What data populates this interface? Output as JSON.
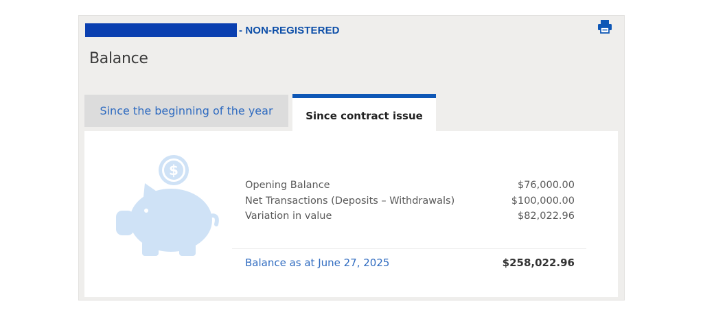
{
  "header": {
    "account_suffix": "- NON-REGISTERED",
    "print_icon": "printer-icon"
  },
  "section": {
    "title": "Balance"
  },
  "tabs": [
    {
      "label": "Since the beginning of the year",
      "active": false
    },
    {
      "label": "Since contract issue",
      "active": true
    }
  ],
  "summary": {
    "illustration_icon": "piggy-bank-dollar-icon",
    "rows": [
      {
        "label": "Opening Balance",
        "value": "$76,000.00"
      },
      {
        "label": "Net Transactions (Deposits – Withdrawals)",
        "value": "$100,000.00"
      },
      {
        "label": "Variation in value",
        "value": "$82,022.96"
      }
    ],
    "total": {
      "label": "Balance as at June 27, 2025",
      "value": "$258,022.96"
    }
  },
  "colors": {
    "brand_blue": "#0e57b6",
    "link_blue": "#2f6bc0",
    "redaction_blue": "#0a3fb0",
    "illustration_blue": "#cfe2f6",
    "card_background": "#efeeec"
  }
}
